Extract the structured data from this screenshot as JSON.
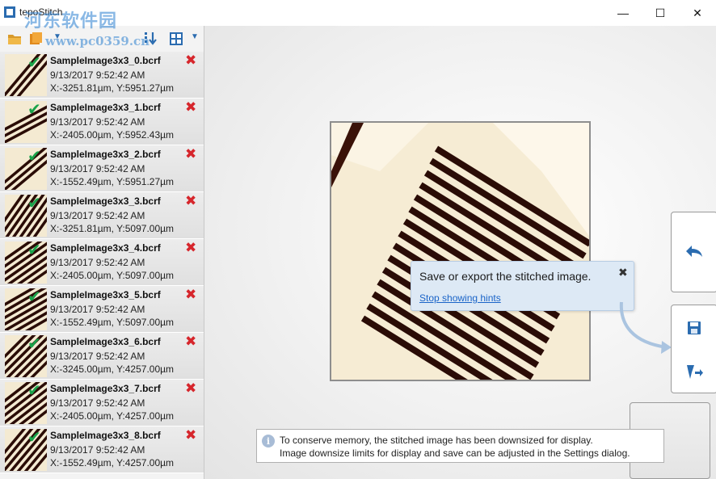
{
  "window": {
    "title": "tepoStitch",
    "minimize": "—",
    "maximize": "☐",
    "close": "✕"
  },
  "watermark": {
    "text": "河东软件园",
    "url": "www.pc0359.cn"
  },
  "files": [
    {
      "name": "SampleImage3x3_0.bcrf",
      "date": "9/13/2017 9:52:42 AM",
      "pos": "X:-3251.81µm, Y:5951.27µm"
    },
    {
      "name": "SampleImage3x3_1.bcrf",
      "date": "9/13/2017 9:52:42 AM",
      "pos": "X:-2405.00µm, Y:5952.43µm"
    },
    {
      "name": "SampleImage3x3_2.bcrf",
      "date": "9/13/2017 9:52:42 AM",
      "pos": "X:-1552.49µm, Y:5951.27µm"
    },
    {
      "name": "SampleImage3x3_3.bcrf",
      "date": "9/13/2017 9:52:42 AM",
      "pos": "X:-3251.81µm, Y:5097.00µm"
    },
    {
      "name": "SampleImage3x3_4.bcrf",
      "date": "9/13/2017 9:52:42 AM",
      "pos": "X:-2405.00µm, Y:5097.00µm"
    },
    {
      "name": "SampleImage3x3_5.bcrf",
      "date": "9/13/2017 9:52:42 AM",
      "pos": "X:-1552.49µm, Y:5097.00µm"
    },
    {
      "name": "SampleImage3x3_6.bcrf",
      "date": "9/13/2017 9:52:42 AM",
      "pos": "X:-3245.00µm, Y:4257.00µm"
    },
    {
      "name": "SampleImage3x3_7.bcrf",
      "date": "9/13/2017 9:52:42 AM",
      "pos": "X:-2405.00µm, Y:4257.00µm"
    },
    {
      "name": "SampleImage3x3_8.bcrf",
      "date": "9/13/2017 9:52:42 AM",
      "pos": "X:-1552.49µm, Y:4257.00µm"
    }
  ],
  "hint": {
    "text": "Save or export the stitched image.",
    "link": "Stop showing hints",
    "close": "✖"
  },
  "info": {
    "line1": "To conserve memory, the stitched image has been downsized for display.",
    "line2": "Image downsize limits for display and save can be adjusted in the Settings dialog.",
    "icon": "i"
  },
  "icons": {
    "check": "✔",
    "remove": "✖"
  },
  "colors": {
    "accent": "#1a64c8",
    "check": "#1aa34a",
    "remove": "#d6262c",
    "stripe": "#2a0c06",
    "sample_bg": "#f6ecd4"
  }
}
